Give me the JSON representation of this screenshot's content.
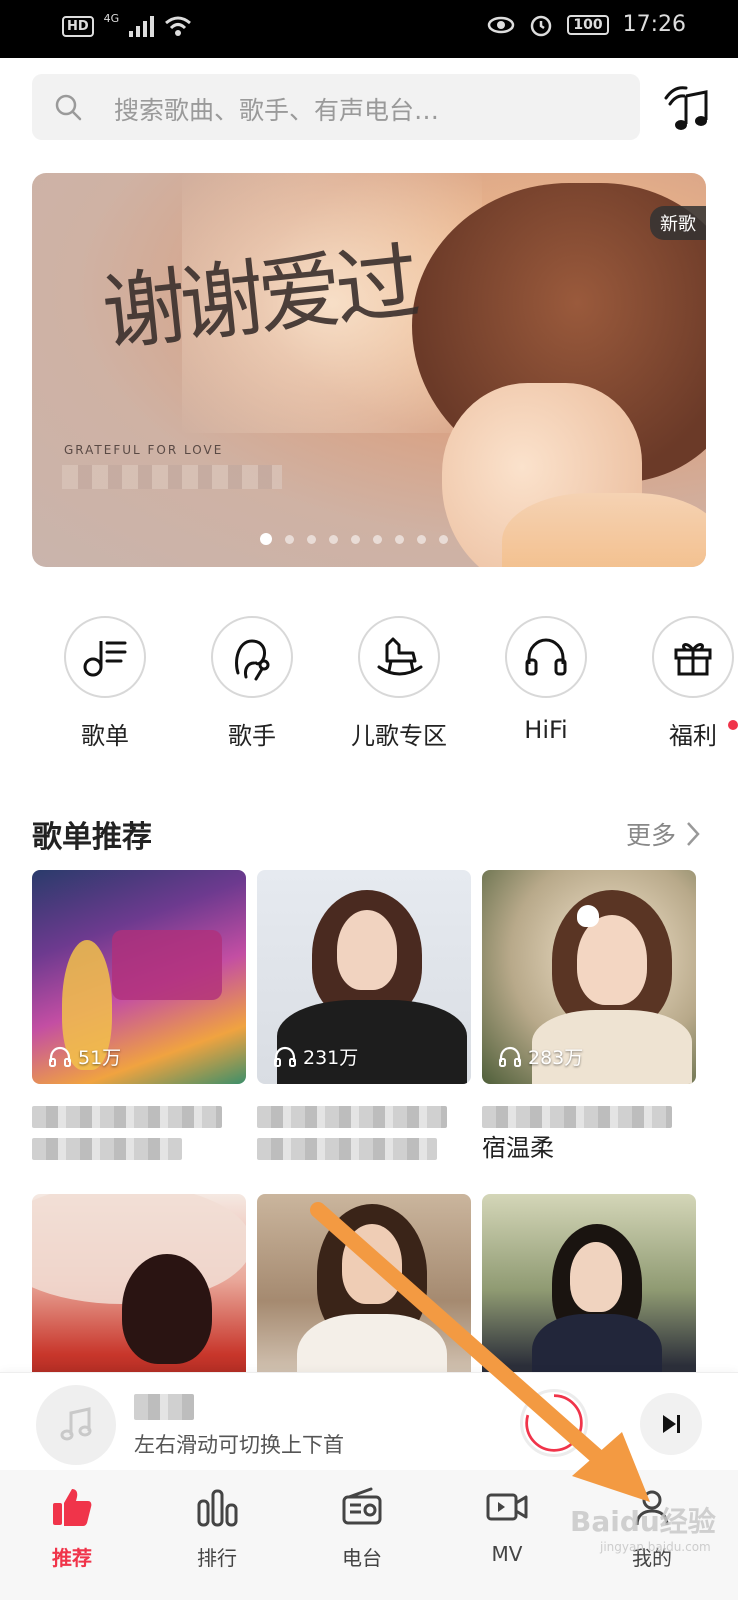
{
  "status_bar": {
    "hd": "HD",
    "net": "4G",
    "battery": "100",
    "time": "17:26"
  },
  "search": {
    "placeholder": "搜索歌曲、歌手、有声电台…"
  },
  "banner": {
    "badge": "新歌",
    "title": "谢谢爱过",
    "subtitle": "GRATEFUL FOR LOVE",
    "page_count": 9,
    "active_page": 1
  },
  "categories": [
    {
      "label": "歌单",
      "icon": "playlist-icon"
    },
    {
      "label": "歌手",
      "icon": "singer-icon"
    },
    {
      "label": "儿歌专区",
      "icon": "rocking-horse-icon"
    },
    {
      "label": "HiFi",
      "icon": "headphones-icon"
    },
    {
      "label": "福利",
      "icon": "gift-icon"
    }
  ],
  "section": {
    "title": "歌单推荐",
    "more": "更多"
  },
  "playlists": [
    {
      "plays": "51万",
      "title_line2": ""
    },
    {
      "plays": "231万",
      "title_line2": ""
    },
    {
      "plays": "283万",
      "title_line2": "宿温柔"
    }
  ],
  "player": {
    "hint": "左右滑动可切换上下首"
  },
  "nav": [
    {
      "label": "推荐",
      "icon": "thumbs-up-icon",
      "active": true
    },
    {
      "label": "排行",
      "icon": "ranking-icon",
      "active": false
    },
    {
      "label": "电台",
      "icon": "radio-icon",
      "active": false
    },
    {
      "label": "MV",
      "icon": "mv-icon",
      "active": false
    },
    {
      "label": "我的",
      "icon": "profile-icon",
      "active": false
    }
  ],
  "watermark": {
    "text": "Baidu经验",
    "sub": "jingyan.baidu.com"
  },
  "colors": {
    "accent": "#f0344a",
    "annotation_arrow": "#f39a42"
  }
}
